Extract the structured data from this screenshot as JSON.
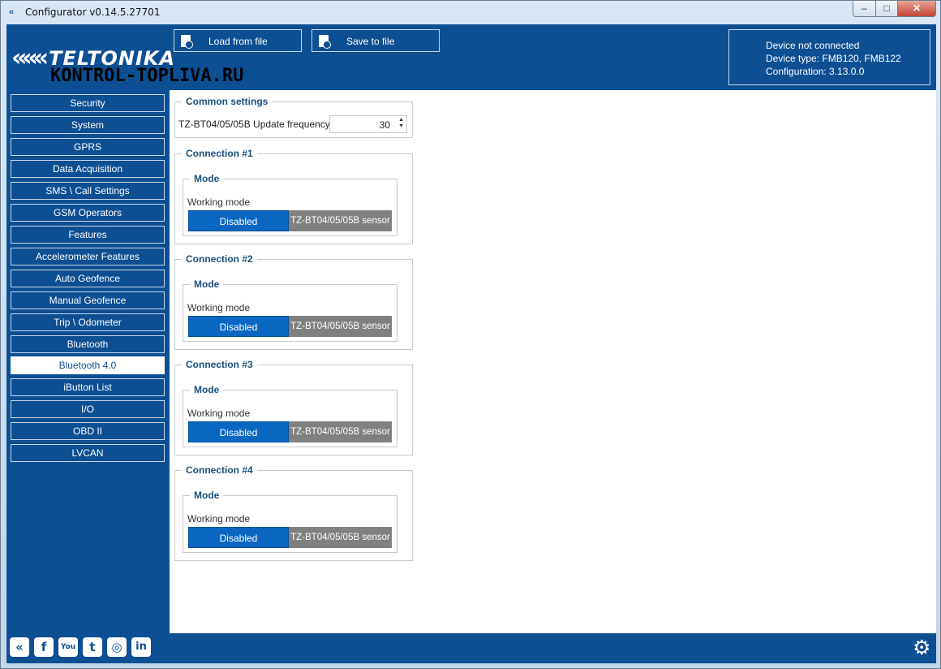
{
  "window": {
    "title": "Configurator v0.14.5.27701",
    "controls": {
      "minimize": "–",
      "maximize": "□",
      "close": "✕"
    }
  },
  "header": {
    "logo_text": "TELTONIKA",
    "watermark": "KONTROL-TOPLIVA.RU",
    "load_button": "Load from file",
    "save_button": "Save to file",
    "status": {
      "connection": "Device not connected",
      "device_type": "Device type: FMB120, FMB122",
      "configuration": "Configuration: 3.13.0.0"
    }
  },
  "sidebar": {
    "items": [
      {
        "label": "Security"
      },
      {
        "label": "System"
      },
      {
        "label": "GPRS"
      },
      {
        "label": "Data Acquisition"
      },
      {
        "label": "SMS \\ Call Settings"
      },
      {
        "label": "GSM Operators"
      },
      {
        "label": "Features"
      },
      {
        "label": "Accelerometer Features"
      },
      {
        "label": "Auto Geofence"
      },
      {
        "label": "Manual Geofence"
      },
      {
        "label": "Trip \\ Odometer"
      },
      {
        "label": "Bluetooth"
      },
      {
        "label": "Bluetooth 4.0"
      },
      {
        "label": "iButton List"
      },
      {
        "label": "I/O"
      },
      {
        "label": "OBD II"
      },
      {
        "label": "LVCAN"
      }
    ],
    "active": "Bluetooth 4.0"
  },
  "main": {
    "common": {
      "title": "Common settings",
      "freq_label": "TZ-BT04/05/05B Update frequency",
      "freq_value": "30"
    },
    "connections": [
      {
        "title": "Connection #1",
        "mode_title": "Mode",
        "working_mode_label": "Working mode",
        "options": [
          "Disabled",
          "TZ-BT04/05/05B sensor"
        ],
        "selected": "Disabled"
      },
      {
        "title": "Connection #2",
        "mode_title": "Mode",
        "working_mode_label": "Working mode",
        "options": [
          "Disabled",
          "TZ-BT04/05/05B sensor"
        ],
        "selected": "Disabled"
      },
      {
        "title": "Connection #3",
        "mode_title": "Mode",
        "working_mode_label": "Working mode",
        "options": [
          "Disabled",
          "TZ-BT04/05/05B sensor"
        ],
        "selected": "Disabled"
      },
      {
        "title": "Connection #4",
        "mode_title": "Mode",
        "working_mode_label": "Working mode",
        "options": [
          "Disabled",
          "TZ-BT04/05/05B sensor"
        ],
        "selected": "Disabled"
      }
    ]
  },
  "footer": {
    "social_icons": [
      "teltonika-icon",
      "facebook-icon",
      "youtube-icon",
      "twitter-icon",
      "instagram-icon",
      "linkedin-icon"
    ],
    "settings_icon": "gear-icon"
  },
  "colors": {
    "brand_blue": "#0c4f93",
    "selected_option": "#0a67c1",
    "unselected_option": "#808080"
  }
}
